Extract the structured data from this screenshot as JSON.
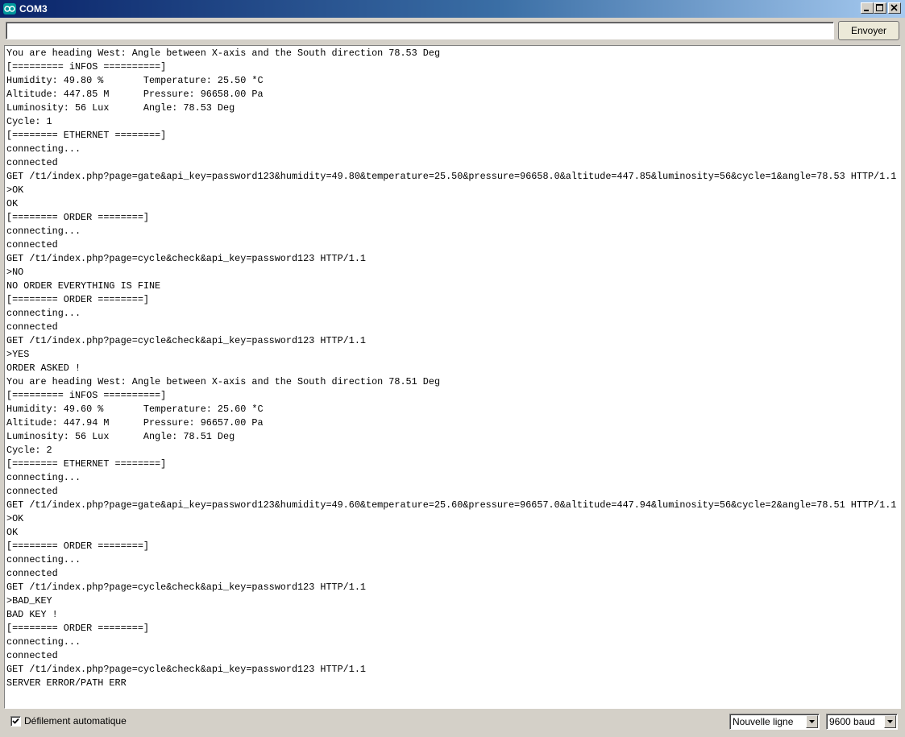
{
  "window": {
    "title": "COM3"
  },
  "send": {
    "input_value": "",
    "button_label": "Envoyer"
  },
  "output_lines": [
    "You are heading West: Angle between X-axis and the South direction 78.53 Deg",
    "[========= iNFOS ==========]",
    "Humidity: 49.80 %       Temperature: 25.50 *C",
    "Altitude: 447.85 M      Pressure: 96658.00 Pa",
    "Luminosity: 56 Lux      Angle: 78.53 Deg",
    "Cycle: 1",
    "[======== ETHERNET ========]",
    "connecting...",
    "connected",
    "GET /t1/index.php?page=gate&api_key=password123&humidity=49.80&temperature=25.50&pressure=96658.0&altitude=447.85&luminosity=56&cycle=1&angle=78.53 HTTP/1.1",
    ">OK",
    "OK",
    "[======== ORDER ========]",
    "connecting...",
    "connected",
    "GET /t1/index.php?page=cycle&check&api_key=password123 HTTP/1.1",
    ">NO",
    "NO ORDER EVERYTHING IS FINE",
    "[======== ORDER ========]",
    "connecting...",
    "connected",
    "GET /t1/index.php?page=cycle&check&api_key=password123 HTTP/1.1",
    ">YES",
    "ORDER ASKED !",
    "You are heading West: Angle between X-axis and the South direction 78.51 Deg",
    "[========= iNFOS ==========]",
    "Humidity: 49.60 %       Temperature: 25.60 *C",
    "Altitude: 447.94 M      Pressure: 96657.00 Pa",
    "Luminosity: 56 Lux      Angle: 78.51 Deg",
    "Cycle: 2",
    "[======== ETHERNET ========]",
    "connecting...",
    "connected",
    "GET /t1/index.php?page=gate&api_key=password123&humidity=49.60&temperature=25.60&pressure=96657.0&altitude=447.94&luminosity=56&cycle=2&angle=78.51 HTTP/1.1",
    ">OK",
    "OK",
    "[======== ORDER ========]",
    "connecting...",
    "connected",
    "GET /t1/index.php?page=cycle&check&api_key=password123 HTTP/1.1",
    ">BAD_KEY",
    "BAD KEY !",
    "[======== ORDER ========]",
    "connecting...",
    "connected",
    "GET /t1/index.php?page=cycle&check&api_key=password123 HTTP/1.1",
    "SERVER ERROR/PATH ERR"
  ],
  "statusbar": {
    "autoscroll_label": "Défilement automatique",
    "autoscroll_checked": true,
    "line_ending": "Nouvelle ligne",
    "baud_rate": "9600 baud"
  },
  "icons": {
    "app": "arduino-icon",
    "minimize": "minimize-icon",
    "maximize": "maximize-icon",
    "close": "close-icon",
    "check": "checkmark-icon",
    "dropdown": "chevron-down-icon"
  },
  "colors": {
    "titlebar_start": "#0a246a",
    "titlebar_end": "#a6caf0",
    "window_bg": "#d4d0c8",
    "app_icon": "#00979c"
  }
}
